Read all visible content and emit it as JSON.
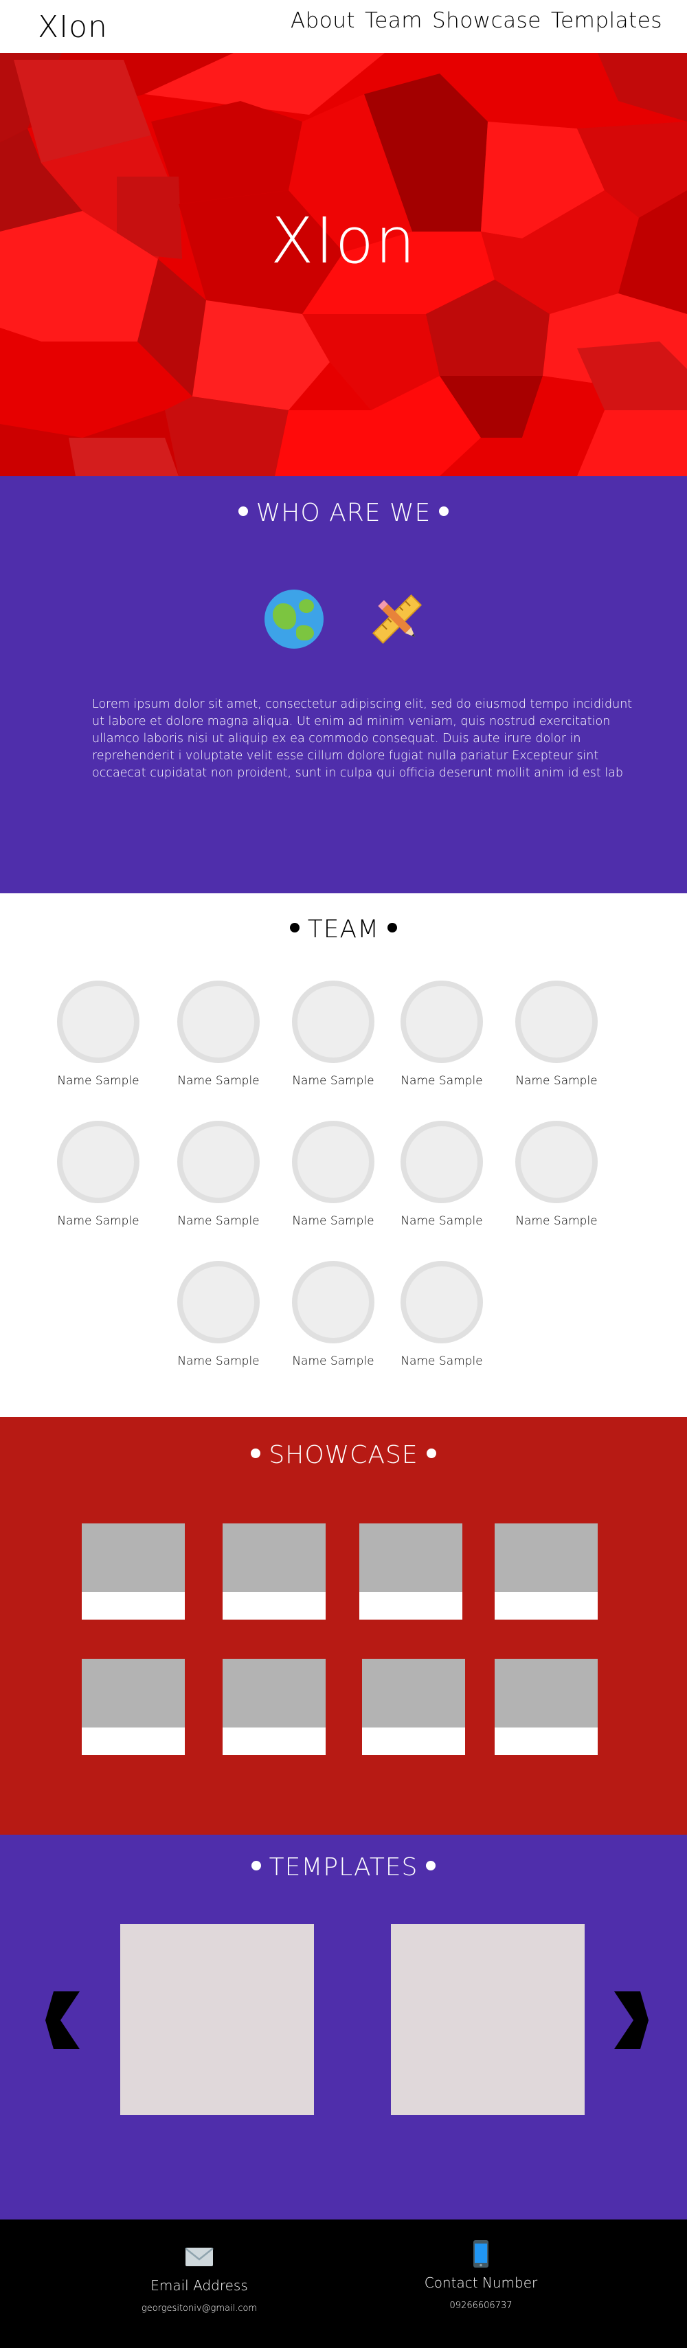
{
  "brand": "XIon",
  "nav": [
    "About",
    "Team",
    "Showcase",
    "Templates"
  ],
  "hero": {
    "title": "XIon"
  },
  "who": {
    "heading": "WHO ARE WE",
    "icons": [
      "globe-icon",
      "ruler-pencil-icon"
    ],
    "text": "Lorem ipsum dolor sit amet, consectetur adipiscing elit, sed do eiusmod tempo incididunt ut labore et dolore magna aliqua. Ut enim ad minim veniam, quis nostrud exercitation ullamco laboris nisi ut aliquip ex ea commodo consequat. Duis aute irure dolor in reprehenderit i voluptate velit esse cillum dolore fugiat nulla pariatur Excepteur sint occaecat cupidatat non proident, sunt in culpa qui officia deserunt mollit anim id est lab"
  },
  "team": {
    "heading": "TEAM",
    "members": [
      "Name Sample",
      "Name Sample",
      "Name Sample",
      "Name Sample",
      "Name Sample",
      "Name Sample",
      "Name Sample",
      "Name Sample",
      "Name Sample",
      "Name Sample",
      "Name Sample",
      "Name Sample",
      "Name Sample"
    ]
  },
  "showcase": {
    "heading": "SHOWCASE",
    "card_count": 8
  },
  "templates": {
    "heading": "TEMPLATES",
    "prev_icon": "chevron-left-icon",
    "next_icon": "chevron-right-icon"
  },
  "footer": {
    "email_label": "Email Address",
    "email_value": "georgesitoniv@gmail.com",
    "phone_label": "Contact Number",
    "phone_value": "09266606737"
  },
  "colors": {
    "hero_red": "#e60000",
    "purple": "#4f2eab",
    "showcase_red": "#b71a14",
    "footer": "#000000"
  }
}
